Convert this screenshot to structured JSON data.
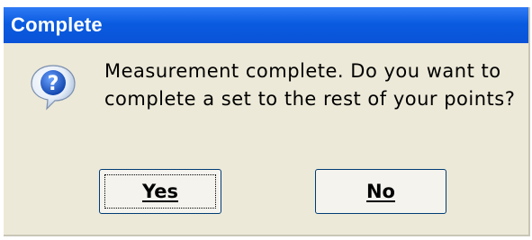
{
  "window": {
    "title": "Complete"
  },
  "dialog": {
    "icon": "question-balloon-icon",
    "message_line1": "Measurement complete. Do you want to",
    "message_line2": "complete a set to the rest of your points?"
  },
  "buttons": {
    "yes_label": "Yes",
    "no_label": "No"
  },
  "colors": {
    "titlebar": "#0A53D8",
    "dialog_bg": "#ECE9D8",
    "button_border": "#003C74"
  }
}
